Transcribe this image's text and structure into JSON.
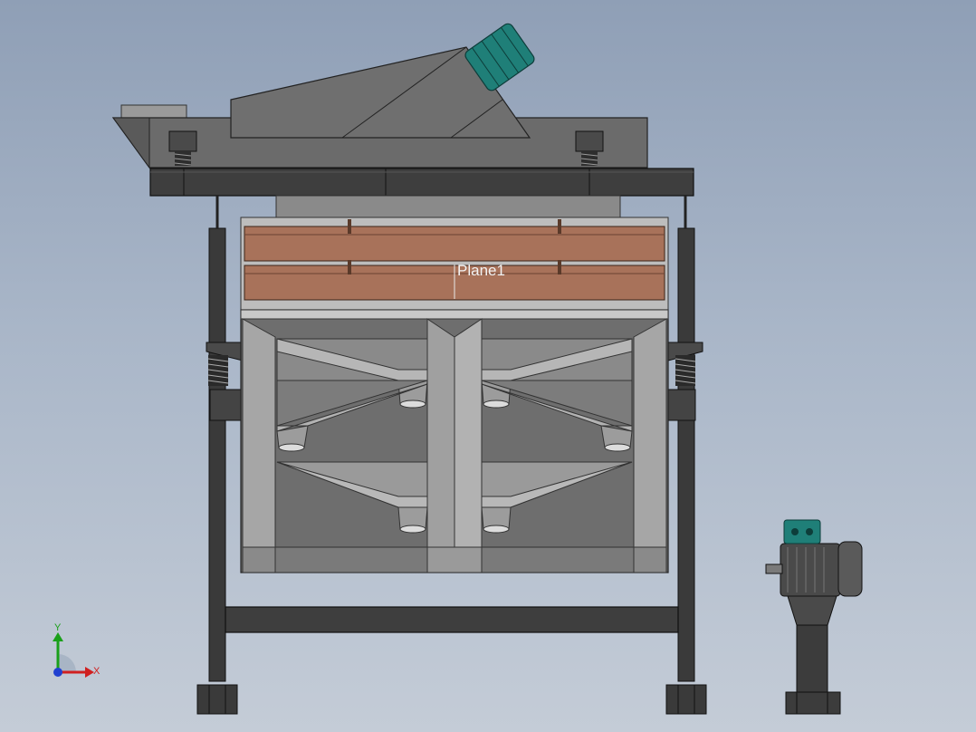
{
  "drawing": {
    "plane_label": "Plane1",
    "colors": {
      "background_top": "#8f9fb6",
      "background_bottom": "#c4ccd7",
      "steel_dark": "#3c3c3c",
      "steel_mid": "#555555",
      "housing_gray": "#6e6e6e",
      "hopper_light": "#b0b0b0",
      "screen_wood": "#a8725a",
      "motor_teal": "#1f7f78",
      "axis_y": "#1aa01a",
      "axis_x": "#d02020",
      "axis_z": "#2040d0"
    }
  },
  "triad": {
    "x_label": "X",
    "y_label": "Y"
  }
}
